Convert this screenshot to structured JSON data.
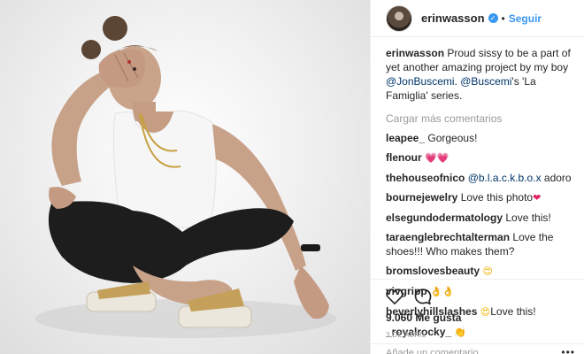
{
  "colors": {
    "link_blue": "#3897f0",
    "mention_blue": "#003569",
    "muted": "#999999",
    "text": "#262626",
    "heart_red": "#e0245e"
  },
  "header": {
    "username": "erinwasson",
    "separator": "•",
    "follow_label": "Seguir",
    "verified_icon": "verified-badge-icon"
  },
  "caption": {
    "username": "erinwasson",
    "text_a": " Proud sissy to be a part of yet another amazing project by my boy ",
    "mention_1": "@JonBuscemi",
    "text_b": ". ",
    "mention_2": "@Buscemi",
    "text_c": "'s 'La Famiglia' series."
  },
  "load_more": "Cargar más comentarios",
  "comments": [
    {
      "user": "leapee_",
      "text": " Gorgeous!"
    },
    {
      "user": "flenour",
      "text": " ",
      "emoji": "💗💗",
      "emoji_class": "e-pink"
    },
    {
      "user": "thehouseofnico",
      "text": " ",
      "mention": "@b.l.a.c.k.b.o.x",
      "text2": " adoro"
    },
    {
      "user": "bournejewelry",
      "text": " Love this photo",
      "emoji": "❤",
      "emoji_class": "e-red"
    },
    {
      "user": "elsegundodermatology",
      "text": " Love this!"
    },
    {
      "user": "taraenglebrechtalterman",
      "text": " Love the shoes!!! Who makes them?"
    },
    {
      "user": "bromslovesbeauty",
      "text": " ",
      "emoji": "😍",
      "emoji_class": "e-yellow"
    },
    {
      "user": "vivgripp",
      "text": " ",
      "emoji": "👌👌",
      "emoji_class": "e-yellow"
    },
    {
      "user": "beverlyhillslashes",
      "text": " ",
      "emoji": "😍",
      "emoji_class": "e-yellow",
      "text2": "Love this!"
    },
    {
      "user": "_royalrocky_",
      "text": " ",
      "emoji": "👏",
      "emoji_class": "e-yellow"
    }
  ],
  "actions": {
    "like_icon": "heart-outline-icon",
    "comment_icon": "comment-bubble-icon"
  },
  "likes_text": "9.060 Me gusta",
  "date_text": "3 DE ABRIL",
  "add_comment_placeholder": "Añade un comentario...",
  "more_icon": "•••"
}
